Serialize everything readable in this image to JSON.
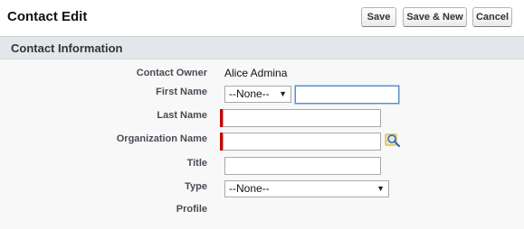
{
  "header": {
    "title": "Contact Edit",
    "buttons": {
      "save": "Save",
      "save_new": "Save & New",
      "cancel": "Cancel"
    }
  },
  "section": {
    "title": "Contact Information"
  },
  "fields": {
    "contact_owner": {
      "label": "Contact Owner",
      "value": "Alice Admina"
    },
    "first_name": {
      "label": "First Name",
      "salutation": "--None--",
      "value": ""
    },
    "last_name": {
      "label": "Last Name",
      "value": "",
      "required": true
    },
    "organization_name": {
      "label": "Organization Name",
      "value": "",
      "required": true
    },
    "title": {
      "label": "Title",
      "value": ""
    },
    "type": {
      "label": "Type",
      "selected": "--None--"
    },
    "profile": {
      "label": "Profile",
      "value": ""
    }
  },
  "icons": {
    "lookup": "magnifier-lookup-icon",
    "dropdown": "chevron-down-icon"
  },
  "colors": {
    "required_marker": "#cc0000",
    "section_bar": "#e3e7ec",
    "focus_border": "#5b8fc8"
  }
}
